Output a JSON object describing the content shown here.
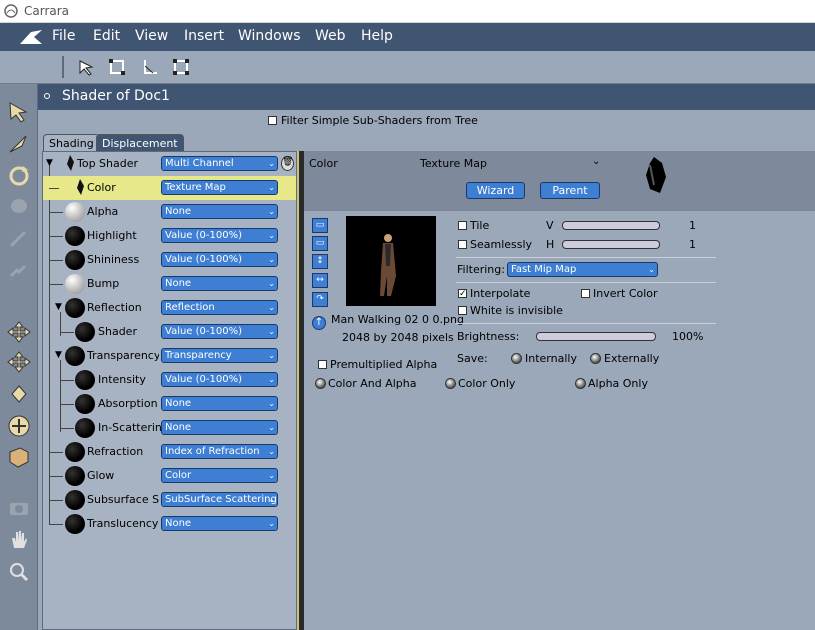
{
  "window": {
    "title": "Carrara"
  },
  "menu": [
    "File",
    "Edit",
    "View",
    "Insert",
    "Windows",
    "Web",
    "Help"
  ],
  "panel": {
    "title": "Shader of Doc1",
    "filter_label": "Filter Simple Sub-Shaders from Tree",
    "tabs": [
      "Shading",
      "Displacement"
    ]
  },
  "tree": [
    {
      "label": "Top Shader",
      "value": "Multi Channel"
    },
    {
      "label": "Color",
      "value": "Texture Map"
    },
    {
      "label": "Alpha",
      "value": "None"
    },
    {
      "label": "Highlight",
      "value": "Value (0-100%)"
    },
    {
      "label": "Shininess",
      "value": "Value (0-100%)"
    },
    {
      "label": "Bump",
      "value": "None"
    },
    {
      "label": "Reflection",
      "value": "Reflection"
    },
    {
      "label": "Shader",
      "value": "Value (0-100%)"
    },
    {
      "label": "Transparency",
      "value": "Transparency"
    },
    {
      "label": "Intensity",
      "value": "Value (0-100%)"
    },
    {
      "label": "Absorption",
      "value": "None"
    },
    {
      "label": "In-Scattering",
      "value": "None"
    },
    {
      "label": "Refraction",
      "value": "Index of Refraction"
    },
    {
      "label": "Glow",
      "value": "Color"
    },
    {
      "label": "Subsurface S",
      "value": "SubSurface Scattering"
    },
    {
      "label": "Translucency",
      "value": "None"
    }
  ],
  "right": {
    "channel": "Color",
    "type": "Texture Map",
    "wizard": "Wizard",
    "parent": "Parent",
    "image_name": "Man Walking 02 0 0.png",
    "image_size": "2048 by 2048 pixels",
    "tile": "Tile",
    "seamlessly": "Seamlessly",
    "v": "V",
    "h": "H",
    "v_val": "1",
    "h_val": "1",
    "filtering_label": "Filtering:",
    "filtering_value": "Fast Mip Map",
    "interpolate": "Interpolate",
    "invert": "Invert Color",
    "white_invisible": "White is invisible",
    "brightness_label": "Brightness:",
    "brightness_value": "100%",
    "save_label": "Save:",
    "internally": "Internally",
    "externally": "Externally",
    "premult": "Premultiplied Alpha",
    "color_alpha": "Color And Alpha",
    "color_only": "Color Only",
    "alpha_only": "Alpha Only"
  }
}
